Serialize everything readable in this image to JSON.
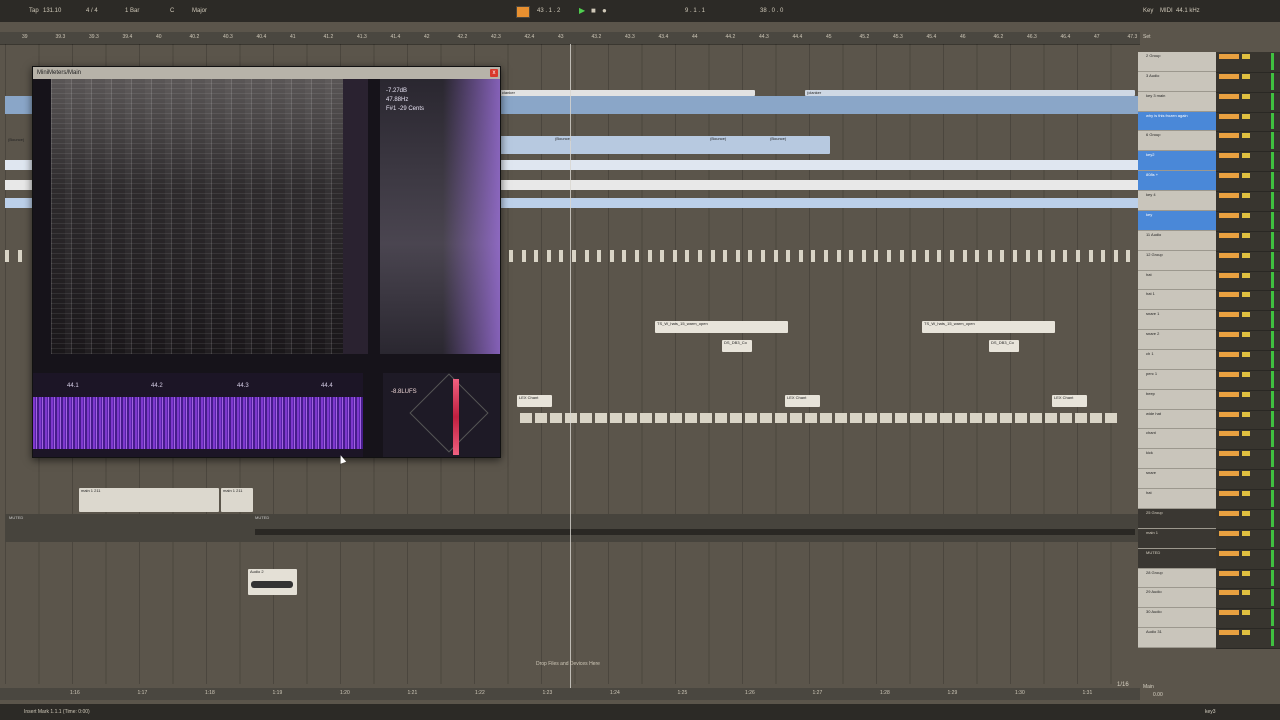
{
  "topbar": {
    "tap": "Tap",
    "tempo": "131.10",
    "meter": "4 / 4",
    "quant": "1 Bar",
    "key": "C",
    "scale": "Major",
    "position": "43 . 1 . 2",
    "loop_start": "9 . 1 . 1",
    "loop_len": "38 . 0 . 0",
    "key_label": "Key",
    "midi_label": "MIDI",
    "sample_rate": "44.1 kHz",
    "set_label": "Set"
  },
  "ruler": [
    "39",
    "39.3",
    "39.3",
    "39.4",
    "40",
    "40.2",
    "40.3",
    "40.4",
    "41",
    "41.2",
    "41.3",
    "41.4",
    "42",
    "42.2",
    "42.3",
    "42.4",
    "43",
    "43.2",
    "43.3",
    "43.4",
    "44",
    "44.2",
    "44.3",
    "44.4",
    "45",
    "45.2",
    "45.3",
    "45.4",
    "46",
    "46.2",
    "46.3",
    "46.4",
    "47",
    "47.3"
  ],
  "bottom_ruler": [
    "1:16",
    "1:17",
    "1:18",
    "1:19",
    "1:20",
    "1:21",
    "1:22",
    "1:23",
    "1:24",
    "1:25",
    "1:26",
    "1:27",
    "1:28",
    "1:29",
    "1:30",
    "1:31"
  ],
  "grid_label": "1/16",
  "clips": {
    "clanker1": "clanker",
    "clanker2": "(clanker",
    "bounce1": "(Bounce)",
    "bounce2": "(Bounce)",
    "bounce3": "(Bounce)",
    "bounce4": "(Bounce)",
    "hats1": "TS_W_hats_15_warm_open",
    "hats2": "TS_W_hats_15_warm_open",
    "ds1": "DS_DB3_Co",
    "ds2": "DS_DB3_Co",
    "chant1": "LEX Chant",
    "chant2": "LEX Chant",
    "chant3": "LEX Chant",
    "main1": "main 1 211",
    "main2": "main 1 211",
    "muted": "MUTED",
    "muted2": "MUTED",
    "audio2": "Audio 2"
  },
  "plugin": {
    "title": "MiniMeters/Main",
    "close": "x",
    "db": "-7.27dB",
    "hz": "47.88Hz",
    "note": "F#1 -29 Cents",
    "wave_labels": [
      "44.1",
      "44.2",
      "44.3",
      "44.4"
    ],
    "lufs": "-8.8LUFS"
  },
  "tracks": [
    {
      "name": "2 Group",
      "sel": false,
      "dark": false
    },
    {
      "name": "3 Audio",
      "sel": false,
      "dark": false
    },
    {
      "name": "key 3 main",
      "sel": false,
      "dark": false
    },
    {
      "name": "why is this frozen again",
      "sel": true,
      "dark": false
    },
    {
      "name": "6 Group",
      "sel": false,
      "dark": false
    },
    {
      "name": "key2",
      "sel": true,
      "dark": false
    },
    {
      "name": "808s +",
      "sel": true,
      "dark": false
    },
    {
      "name": "key 4",
      "sel": false,
      "dark": false
    },
    {
      "name": "key",
      "sel": true,
      "dark": false
    },
    {
      "name": "11 Audio",
      "sel": false,
      "dark": false
    },
    {
      "name": "12 Group",
      "sel": false,
      "dark": false
    },
    {
      "name": "hat",
      "sel": false,
      "dark": false
    },
    {
      "name": "hat 1",
      "sel": false,
      "dark": false
    },
    {
      "name": "snare 1",
      "sel": false,
      "dark": false
    },
    {
      "name": "snare 2",
      "sel": false,
      "dark": false
    },
    {
      "name": "ch 1",
      "sel": false,
      "dark": false
    },
    {
      "name": "perc 1",
      "sel": false,
      "dark": false
    },
    {
      "name": "beep",
      "sel": false,
      "dark": false
    },
    {
      "name": "wide hat",
      "sel": false,
      "dark": false
    },
    {
      "name": "chant",
      "sel": false,
      "dark": false
    },
    {
      "name": "kick",
      "sel": false,
      "dark": false
    },
    {
      "name": "snare",
      "sel": false,
      "dark": false
    },
    {
      "name": "hat",
      "sel": false,
      "dark": false
    },
    {
      "name": "25 Group",
      "sel": false,
      "dark": true
    },
    {
      "name": "main 1",
      "sel": false,
      "dark": true
    },
    {
      "name": "MUTED",
      "sel": false,
      "dark": true
    },
    {
      "name": "28 Group",
      "sel": false,
      "dark": false
    },
    {
      "name": "29 Audio",
      "sel": false,
      "dark": false
    },
    {
      "name": "30 Audio",
      "sel": false,
      "dark": false
    },
    {
      "name": "Audio 31",
      "sel": false,
      "dark": false
    }
  ],
  "master": {
    "name": "Main",
    "vol": "0.00"
  },
  "drop_hint": "Drop Files and Devices Here",
  "status": {
    "text": "Insert Mark 1.1.1 (Time: 0:00)",
    "right": "key3"
  },
  "colors": {
    "accent": "#4a88d8",
    "violet": "#8a3de0",
    "orange": "#e8a040",
    "green": "#40c040"
  }
}
